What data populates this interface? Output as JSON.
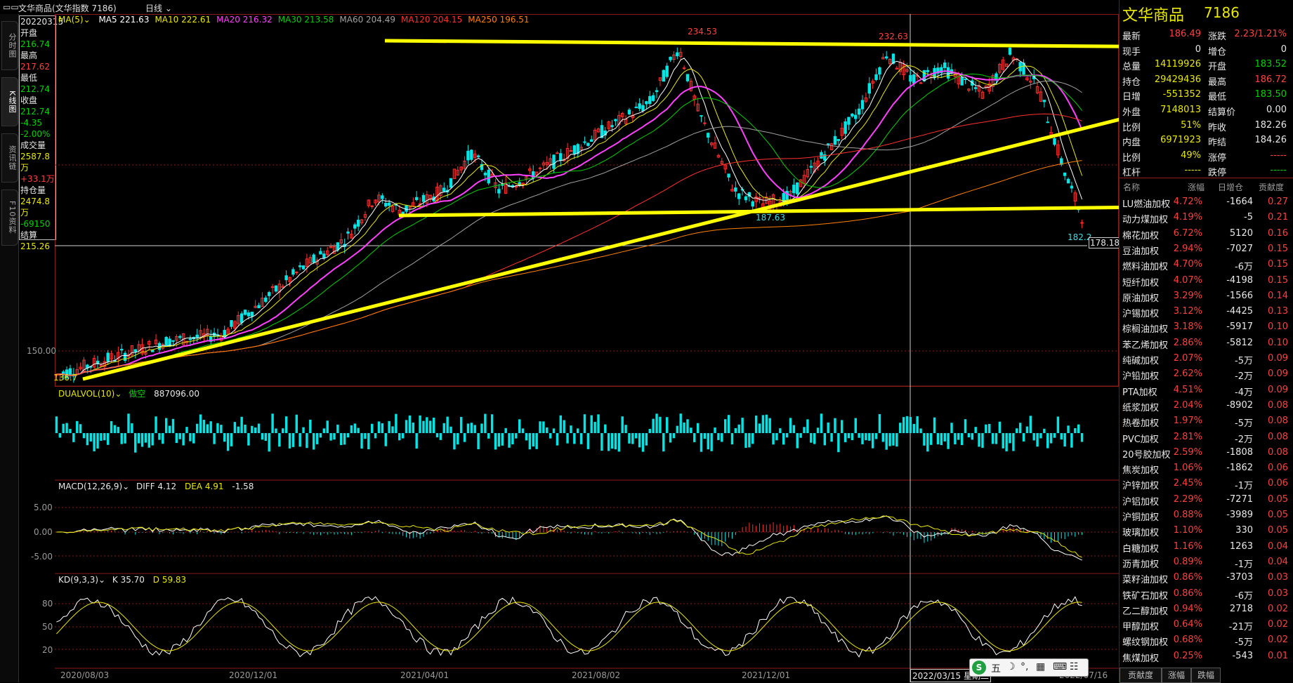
{
  "window": {
    "menu_glyph": "▭▭",
    "title": "文华商品(文华指数 7186)",
    "period": "日线"
  },
  "left_tabs": [
    "分时图",
    "K线图",
    "资讯链",
    "F10资料"
  ],
  "infobox": {
    "date": "20220315",
    "open_label": "开盘",
    "open": "216.74",
    "high_label": "最高",
    "high": "217.62",
    "low_label": "最低",
    "low": "212.74",
    "close_label": "收盘",
    "close": "212.74",
    "change": "-4.35",
    "change_pct": "-2.00%",
    "volume_label": "成交量",
    "volume": "2587.8万",
    "volume_change": "+33.1万",
    "oi_label": "持仓量",
    "oi": "2474.8万",
    "oi_change": "-69150",
    "settle_label": "结算",
    "settle": "215.26"
  },
  "ma_legend": {
    "name": "MA(5)",
    "items": [
      {
        "label": "MA5 221.63",
        "color": "#ffffff"
      },
      {
        "label": "MA10 222.61",
        "color": "#e8e800"
      },
      {
        "label": "MA20 216.32",
        "color": "#ff40ff"
      },
      {
        "label": "MA30 213.58",
        "color": "#00d000"
      },
      {
        "label": "MA60 204.49",
        "color": "#a0a0a0"
      },
      {
        "label": "MA120 204.15",
        "color": "#ff3030"
      },
      {
        "label": "MA250 196.51",
        "color": "#ff8000"
      }
    ]
  },
  "price_annotations": {
    "peak1": "234.53",
    "peak2": "232.63",
    "trough": "187.63",
    "last_low": "182.2",
    "cross_price": "178.18",
    "y_tick": "150.00",
    "bottom_left": "136.7"
  },
  "dualvol": {
    "name": "DUALVOL(10)",
    "mode": "做空",
    "value": "887096.00"
  },
  "macd": {
    "name": "MACD(12,26,9)",
    "diff": "DIFF 4.12",
    "dea": "DEA 4.91",
    "macd": "-1.58",
    "ticks": [
      "5.00",
      "0.00",
      "-5.00"
    ]
  },
  "kd": {
    "name": "KD(9,3,3)",
    "k": "K 35.70",
    "d": "D 59.83",
    "ticks": [
      "80",
      "50",
      "20"
    ]
  },
  "x_axis": {
    "labels": [
      "2020/08/03",
      "2020/12/01",
      "2021/04/01",
      "2021/08/02",
      "2021/12/01",
      "2022/03/15 星期二",
      "2022/07/16"
    ]
  },
  "ime_bar": {
    "logo": "S",
    "items": [
      "五",
      "☽",
      "°,",
      "▦",
      "⌨",
      "☷"
    ]
  },
  "quote": {
    "name": "文华商品",
    "code": "7186",
    "rows": [
      {
        "l1": "最新",
        "v1": "186.49",
        "c1": "red",
        "l2": "涨跌",
        "v2": "2.23/1.21%",
        "c2": "red"
      },
      {
        "l1": "现手",
        "v1": "0",
        "c1": "wht",
        "l2": "增仓",
        "v2": "0",
        "c2": "wht"
      },
      {
        "l1": "总量",
        "v1": "14119926",
        "c1": "yel",
        "l2": "开盘",
        "v2": "183.52",
        "c2": "grn"
      },
      {
        "l1": "持仓",
        "v1": "29429436",
        "c1": "yel",
        "l2": "最高",
        "v2": "186.72",
        "c2": "red"
      },
      {
        "l1": "日增",
        "v1": "-551352",
        "c1": "yel",
        "l2": "最低",
        "v2": "183.50",
        "c2": "grn"
      },
      {
        "l1": "外盘",
        "v1": "7148013",
        "c1": "yel",
        "l2": "结算价",
        "v2": "0.00",
        "c2": "wht"
      },
      {
        "l1": "比例",
        "v1": "51%",
        "c1": "yel",
        "l2": "昨收",
        "v2": "182.26",
        "c2": "wht"
      },
      {
        "l1": "内盘",
        "v1": "6971923",
        "c1": "yel",
        "l2": "昨结",
        "v2": "184.26",
        "c2": "wht"
      },
      {
        "l1": "比例",
        "v1": "49%",
        "c1": "yel",
        "l2": "涨停",
        "v2": "-----",
        "c2": "red"
      },
      {
        "l1": "杠杆",
        "v1": "-----",
        "c1": "yel",
        "l2": "跌停",
        "v2": "-----",
        "c2": "grn"
      }
    ]
  },
  "contrib": {
    "headers": [
      "名称",
      "涨幅",
      "日增仓",
      "贡献度"
    ],
    "rows": [
      [
        "LU燃油加权",
        "4.72%",
        "-1664",
        "0.27"
      ],
      [
        "动力煤加权",
        "4.19%",
        "-5",
        "0.21"
      ],
      [
        "棉花加权",
        "6.72%",
        "5120",
        "0.16"
      ],
      [
        "豆油加权",
        "2.94%",
        "-7027",
        "0.15"
      ],
      [
        "燃料油加权",
        "4.70%",
        "-6万",
        "0.15"
      ],
      [
        "短纤加权",
        "4.07%",
        "-4198",
        "0.15"
      ],
      [
        "原油加权",
        "3.29%",
        "-1566",
        "0.14"
      ],
      [
        "沪锡加权",
        "3.12%",
        "-4425",
        "0.13"
      ],
      [
        "棕榈油加权",
        "3.18%",
        "-5917",
        "0.10"
      ],
      [
        "苯乙烯加权",
        "2.86%",
        "-5812",
        "0.10"
      ],
      [
        "纯碱加权",
        "2.07%",
        "-5万",
        "0.09"
      ],
      [
        "沪铅加权",
        "2.62%",
        "-2万",
        "0.09"
      ],
      [
        "PTA加权",
        "4.51%",
        "-4万",
        "0.09"
      ],
      [
        "纸浆加权",
        "2.04%",
        "-8902",
        "0.08"
      ],
      [
        "热卷加权",
        "1.97%",
        "-5万",
        "0.08"
      ],
      [
        "PVC加权",
        "2.81%",
        "-2万",
        "0.08"
      ],
      [
        "20号胶加权",
        "2.59%",
        "-1808",
        "0.08"
      ],
      [
        "焦炭加权",
        "1.06%",
        "-1862",
        "0.06"
      ],
      [
        "沪锌加权",
        "2.45%",
        "-1万",
        "0.06"
      ],
      [
        "沪铝加权",
        "2.29%",
        "-7271",
        "0.05"
      ],
      [
        "沪铜加权",
        "0.88%",
        "-3989",
        "0.05"
      ],
      [
        "玻璃加权",
        "1.10%",
        "330",
        "0.05"
      ],
      [
        "白糖加权",
        "1.16%",
        "1263",
        "0.04"
      ],
      [
        "沥青加权",
        "0.89%",
        "-1万",
        "0.04"
      ],
      [
        "菜籽油加权",
        "0.86%",
        "-3703",
        "0.03"
      ],
      [
        "铁矿石加权",
        "0.86%",
        "-6万",
        "0.03"
      ],
      [
        "乙二醇加权",
        "0.94%",
        "2718",
        "0.02"
      ],
      [
        "甲醇加权",
        "0.64%",
        "-21万",
        "0.02"
      ],
      [
        "螺纹钢加权",
        "0.68%",
        "-5万",
        "0.02"
      ],
      [
        "焦煤加权",
        "0.25%",
        "-543",
        "0.01"
      ]
    ],
    "tabs": [
      "贡献度",
      "涨幅",
      "跌幅"
    ]
  },
  "colors": {
    "panel_border": "#8b1a1a",
    "annotation": "#ffff00",
    "volume": "#00e5e5",
    "up": "#ff3030",
    "down": "#00e5e5"
  }
}
